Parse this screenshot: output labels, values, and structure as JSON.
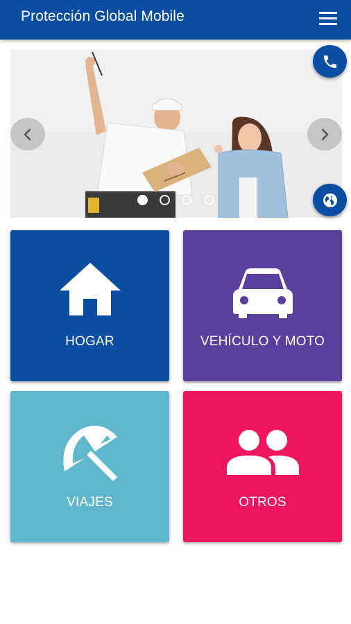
{
  "app": {
    "title": "Protección Global Mobile",
    "menu_icon": "hamburger-menu-icon"
  },
  "colors": {
    "primary": "#0a4ea3",
    "hogar": "#0a4ea3",
    "vehiculo": "#5b3f9f",
    "viajes": "#5fb7cb",
    "otros": "#ef155d"
  },
  "carousel": {
    "slide_count": 4,
    "active_index": 0,
    "prev_icon": "chevron-left-icon",
    "next_icon": "chevron-right-icon"
  },
  "actions": {
    "phone_icon": "phone-icon",
    "web_icon": "globe-icon"
  },
  "tiles": [
    {
      "label": "HOGAR",
      "icon": "house-icon"
    },
    {
      "label": "VEHÍCULO Y MOTO",
      "icon": "car-icon"
    },
    {
      "label": "VIAJES",
      "icon": "beach-umbrella-icon"
    },
    {
      "label": "OTROS",
      "icon": "people-icon"
    }
  ]
}
